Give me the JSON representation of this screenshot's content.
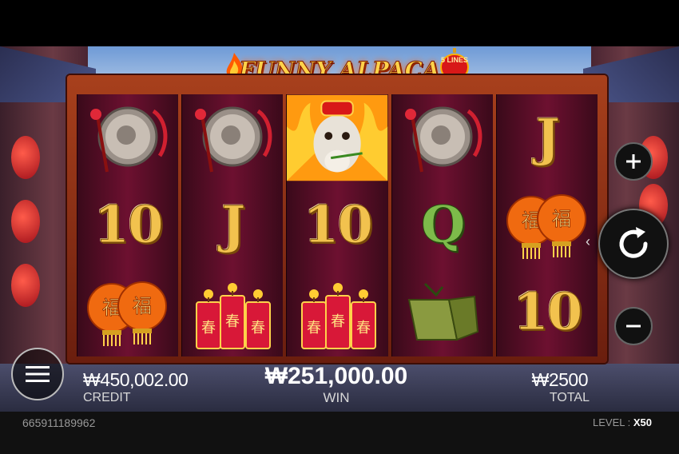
{
  "game": {
    "title": "FUNNY ALPACA",
    "lines_badge": "5 LINES"
  },
  "reels": [
    [
      "gong-icon",
      "10",
      "lanterns-icon"
    ],
    [
      "gong-icon",
      "J",
      "firecrackers-icon"
    ],
    [
      "alpaca-wild-icon",
      "10",
      "firecrackers-icon"
    ],
    [
      "gong-icon",
      "Q",
      "jade-tokens-icon"
    ],
    [
      "J",
      "lanterns-icon",
      "10"
    ]
  ],
  "lantern_char": "福",
  "firecracker_char": "春",
  "stats": {
    "credit_value": "₩450,002.00",
    "credit_label": "CREDIT",
    "win_value": "₩251,000.00",
    "win_label": "WIN",
    "total_value": "₩2500",
    "total_label": "TOTAL"
  },
  "footer": {
    "round_id": "665911189962",
    "level_label": "LEVEL :",
    "level_value": "X50"
  },
  "colors": {
    "reel_bg": "#6d1030",
    "gold": "#f2c24e",
    "green": "#7dbb4a",
    "frame": "#a8401c"
  }
}
